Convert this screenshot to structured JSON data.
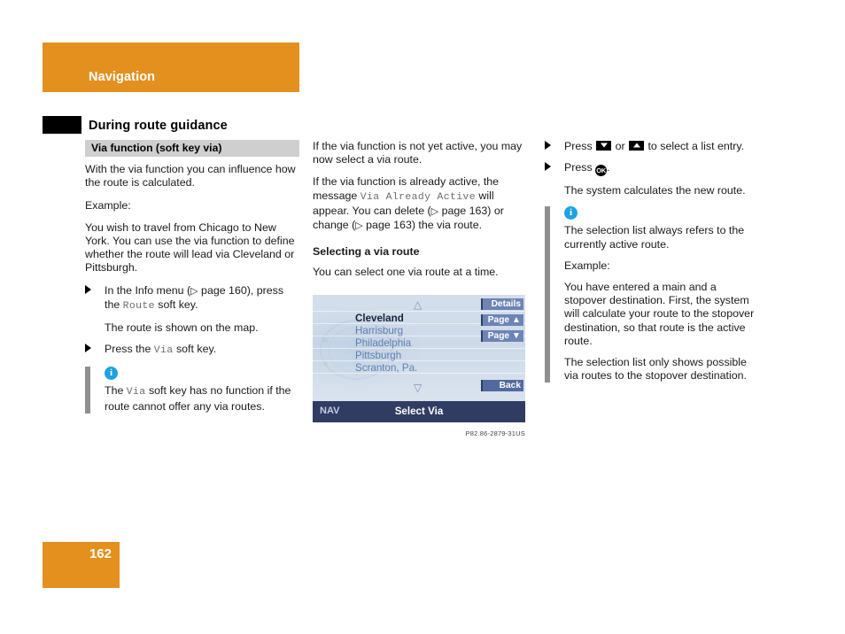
{
  "header": {
    "title": "Navigation",
    "subtitle": "During route guidance",
    "band_color": "#e3901f"
  },
  "footer": {
    "page_number": "162"
  },
  "left_column": {
    "section_title": "Via function (soft key via)",
    "para1": "With the via function you can influence how the route is calculated.",
    "para2": "Example:",
    "para3": "You wish to travel from Chicago to New York. You can use the via function to define whether the route will lead via Cleveland or Pittsburgh.",
    "step1_pre": "In the Info menu (",
    "step1_ref": "page 160",
    "step1_mid": "), press the ",
    "step1_mono": "Route",
    "step1_post": " soft key.",
    "step1_result": "The route is shown on the map.",
    "step2_pre": "Press the ",
    "step2_mono": "Via",
    "step2_post": " soft key.",
    "note_pre": "The ",
    "note_mono": "Via",
    "note_post": " soft key has no function if the route cannot offer any via routes."
  },
  "middle_column": {
    "para1": "If the via function is not yet active, you may now select a via route.",
    "para2_pre": "If the via function is already active, the message ",
    "para2_mono": "Via Already Active",
    "para2_mid": " will appear. You can delete (",
    "para2_ref1": "page 163",
    "para2_mid2": ") or change (",
    "para2_ref2": "page 163",
    "para2_post": ") the via route.",
    "sub_head": "Selecting a via route",
    "para3": "You can select one via route at a time."
  },
  "figure": {
    "caption": "P82.86-2879-31US",
    "entries": [
      "Cleveland",
      "Harrisburg",
      "Philadelphia",
      "Pittsburgh",
      "Scranton, Pa."
    ],
    "selected_index": 0,
    "softkeys": [
      "Details",
      "Page ▲",
      "Page ▼"
    ],
    "back_key": "Back",
    "status_left": "NAV",
    "status_center": "Select Via",
    "scroll_up_icon": "△",
    "scroll_down_icon": "▽",
    "colors": {
      "screen_bg": "#c8d5e6",
      "softkey": "#6d84b4",
      "status_bar": "#313c63",
      "entry_text": "#5f7fae",
      "selected_text": "#16233a"
    }
  },
  "right_column": {
    "step1_pre": "Press ",
    "step1_or": " or ",
    "step1_post": " to select a list entry.",
    "step2_pre": "Press ",
    "step2_post": ".",
    "step2_result": "The system calculates the new route.",
    "note_para1": "The selection list always refers to the currently active route.",
    "note_para2": "Example:",
    "note_para3": "You have entered a main and a stopover destination. First, the system will calculate your route to the stopover destination, so that route is the active route.",
    "note_para4": "The selection list only shows possible via routes to the stopover destination.",
    "key_down_icon": "down-arrow-key",
    "key_up_icon": "up-arrow-key",
    "key_ok_label": "OK"
  }
}
